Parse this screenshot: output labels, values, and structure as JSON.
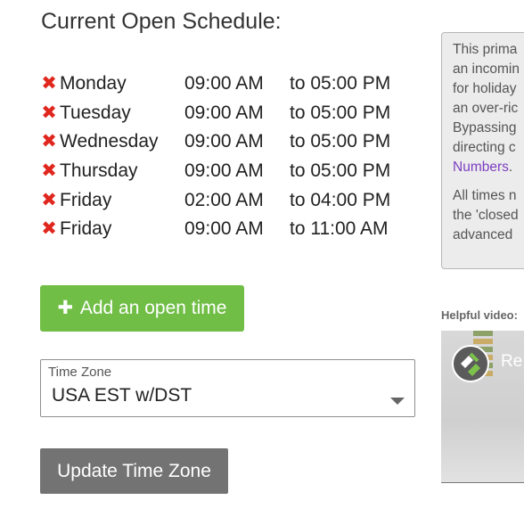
{
  "header": {
    "title": "Current Open Schedule:"
  },
  "schedule": [
    {
      "day": "Monday",
      "from": "09:00 AM",
      "to": "to 05:00 PM"
    },
    {
      "day": "Tuesday",
      "from": "09:00 AM",
      "to": "to 05:00 PM"
    },
    {
      "day": "Wednesday",
      "from": "09:00 AM",
      "to": "to 05:00 PM"
    },
    {
      "day": "Thursday",
      "from": "09:00 AM",
      "to": "to 05:00 PM"
    },
    {
      "day": "Friday",
      "from": "02:00 AM",
      "to": "to 04:00 PM"
    },
    {
      "day": "Friday",
      "from": "09:00 AM",
      "to": "to 11:00 AM"
    }
  ],
  "icons": {
    "remove": "close-x-icon",
    "add": "plus-icon",
    "dropdown": "caret-down-icon"
  },
  "colors": {
    "remove": "#e0271e",
    "add_button": "#70be46",
    "update_button": "#737373",
    "link": "#7d3fc2"
  },
  "add_button": {
    "label": "Add an open time"
  },
  "timezone": {
    "label": "Time Zone",
    "value": "USA EST w/DST"
  },
  "update_button": {
    "label": "Update Time Zone"
  },
  "info": {
    "lines": [
      "This prima",
      "an incomin",
      "for holiday",
      "an over-ric",
      "Bypassing",
      "directing c"
    ],
    "link_text": "Numbers",
    "link_suffix": ".",
    "lines2": [
      "All times n",
      "the 'closed",
      "advanced"
    ]
  },
  "helpful": {
    "label": "Helpful video:"
  },
  "video": {
    "title": "Re"
  }
}
